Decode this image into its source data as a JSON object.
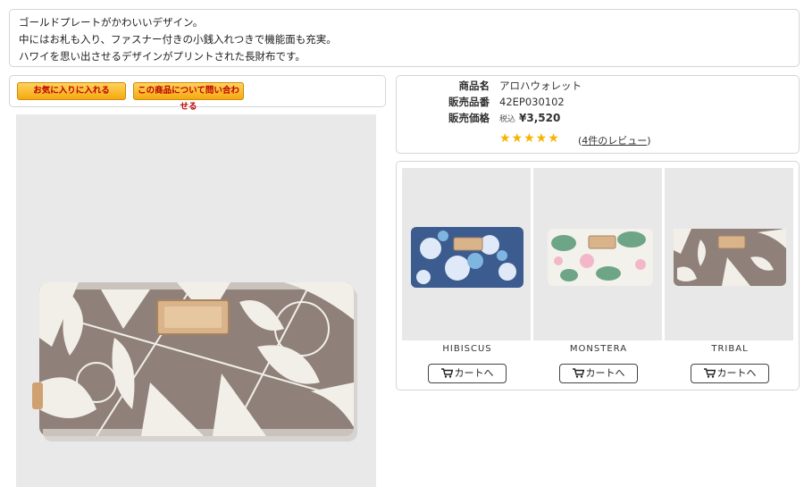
{
  "description": {
    "lines": [
      "ゴールドプレートがかわいいデザイン。",
      "中にはお札も入り、ファスナー付きの小銭入れつきで機能面も充実。",
      "ハワイを思い出させるデザインがプリントされた長財布です。"
    ]
  },
  "actions": {
    "favorite_label": "お気に入りに入れる",
    "inquiry_label": "この商品について問い合わせる"
  },
  "product": {
    "name_label": "商品名",
    "name_value": "アロハウォレット",
    "code_label": "販売品番",
    "code_value": "42EP030102",
    "price_label": "販売価格",
    "tax_label": "税込",
    "price_value": "¥3,520",
    "colon": "：",
    "rating_stars": "★★★★★",
    "rating": 5,
    "review_link": "4件のレビュー"
  },
  "variants": [
    {
      "name": "HIBISCUS",
      "cart_label": "カートへ"
    },
    {
      "name": "MONSTERA",
      "cart_label": "カートへ"
    },
    {
      "name": "TRIBAL",
      "cart_label": "カートへ"
    }
  ],
  "colors": {
    "button_orange": "#f5a90f",
    "button_text": "#bb0000",
    "star": "#f5b400",
    "border": "#d5d5d5"
  }
}
